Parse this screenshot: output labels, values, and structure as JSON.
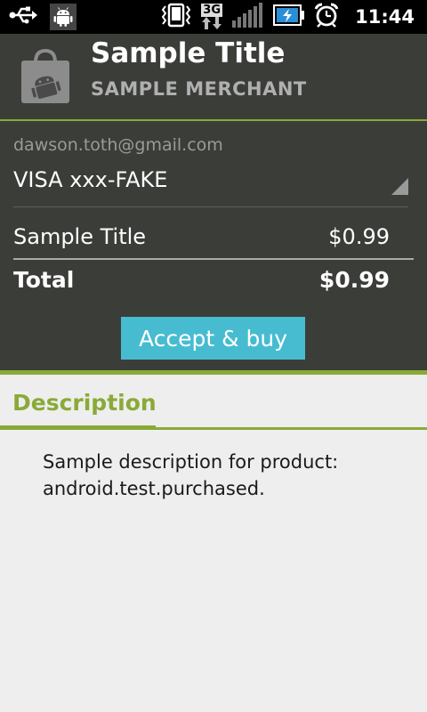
{
  "status_bar": {
    "time": "11:44",
    "network_label": "3G",
    "icons": [
      "usb-icon",
      "android-debug-icon",
      "vibrate-icon",
      "3g-icon",
      "signal-icon",
      "battery-charging-icon",
      "alarm-icon"
    ]
  },
  "product": {
    "title": "Sample Title",
    "merchant": "SAMPLE MERCHANT"
  },
  "payment": {
    "account": "dawson.toth@gmail.com",
    "card": "VISA xxx-FAKE"
  },
  "order": {
    "item_name": "Sample Title",
    "item_price": "$0.99",
    "total_label": "Total",
    "total_value": "$0.99"
  },
  "actions": {
    "buy_label": "Accept & buy"
  },
  "description": {
    "tab_label": "Description",
    "text": "Sample description for product: android.test.purchased."
  },
  "colors": {
    "accent": "#8aaa38",
    "button": "#47bcd1",
    "panel": "#3b3d39",
    "background": "#eeeeee"
  }
}
